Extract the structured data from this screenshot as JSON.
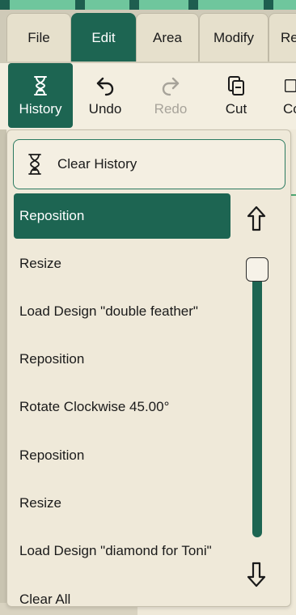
{
  "tabs": [
    {
      "label": "File"
    },
    {
      "label": "Edit"
    },
    {
      "label": "Area"
    },
    {
      "label": "Modify"
    },
    {
      "label": "Re"
    }
  ],
  "ribbon": {
    "history_label": "History",
    "undo_label": "Undo",
    "redo_label": "Redo",
    "cut_label": "Cut",
    "copy_label": "Co"
  },
  "history_panel": {
    "clear_history_label": "Clear History",
    "items": [
      {
        "label": "Reposition",
        "selected": true
      },
      {
        "label": "Resize"
      },
      {
        "label": "Load Design \"double feather\""
      },
      {
        "label": "Reposition"
      },
      {
        "label": "Rotate Clockwise 45.00°"
      },
      {
        "label": "Reposition"
      },
      {
        "label": "Resize"
      },
      {
        "label": "Load Design \"diamond for Toni\""
      },
      {
        "label": "Clear All"
      }
    ]
  },
  "colors": {
    "accent": "#1d6552",
    "background": "#efe9d9",
    "top_strip": "#6fc69d"
  }
}
